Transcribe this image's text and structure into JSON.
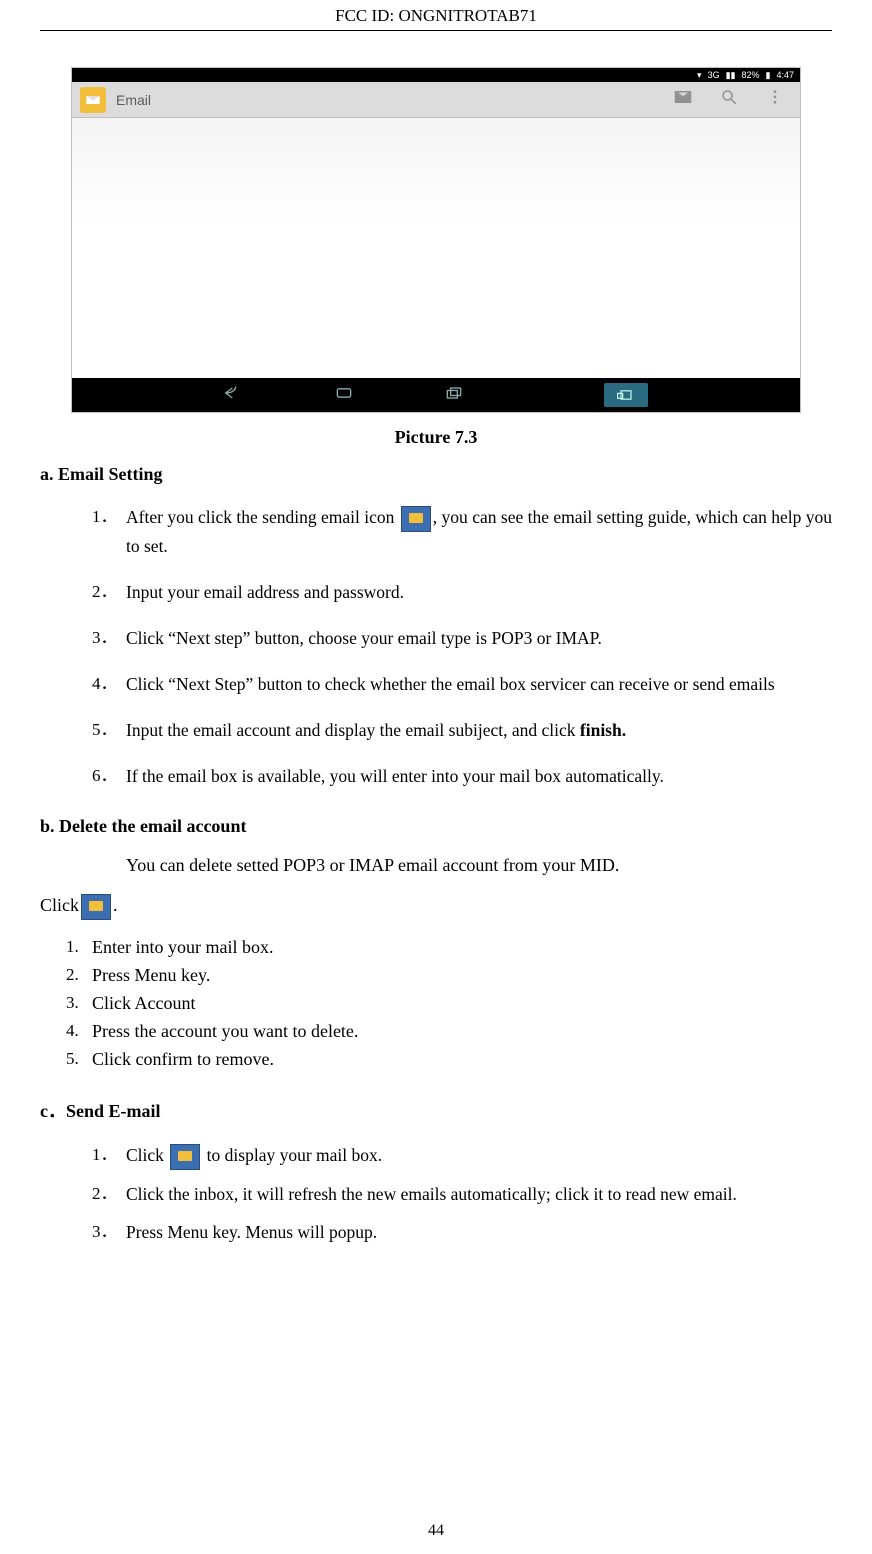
{
  "header": {
    "fcc_label": "FCC ID:",
    "fcc_id": "ONGNITROTAB71"
  },
  "screenshot": {
    "statusbar": {
      "net": "3G",
      "batt_pct": "82%",
      "time": "4:47"
    },
    "appbar": {
      "title": "Email"
    }
  },
  "caption": "Picture 7.3",
  "section_a": {
    "heading": "a. Email Setting",
    "items": [
      {
        "n": "1．",
        "pre": "After you click the sending email icon ",
        "post": ", you can see the email setting guide, which can help you to set."
      },
      {
        "n": "2．",
        "text": "Input your email address and password."
      },
      {
        "n": "3．",
        "text": "Click “Next step” button, choose your email type is POP3 or IMAP."
      },
      {
        "n": "4．",
        "text": "Click “Next Step” button to check whether the email box servicer can receive or send emails"
      },
      {
        "n": "5．",
        "pre": "Input the email account and display the email subiject, and click ",
        "bold": "finish."
      },
      {
        "n": "6．",
        "text": "If the email box is available, you will enter into your mail box automatically."
      }
    ]
  },
  "section_b": {
    "heading": "b. Delete the email account",
    "intro": "You can delete setted POP3 or IMAP email account from your MID.",
    "click_pre": "Click",
    "click_post": ".",
    "items": [
      {
        "n": "1.",
        "text": "Enter into your mail box."
      },
      {
        "n": "2.",
        "text": "Press Menu key."
      },
      {
        "n": "3.",
        "text": "Click Account"
      },
      {
        "n": "4.",
        "text": "Press the account you want to delete."
      },
      {
        "n": "5.",
        "text": "Click confirm to remove."
      }
    ]
  },
  "section_c": {
    "prefix": "c．",
    "heading": "Send E-mail",
    "items": [
      {
        "n": "1．",
        "pre": "Click ",
        "post": " to display your mail box."
      },
      {
        "n": "2．",
        "text": " Click the inbox, it will refresh the new emails automatically; click it to read new email."
      },
      {
        "n": "3．",
        "text": "Press Menu key. Menus will popup."
      }
    ]
  },
  "page_number": "44"
}
